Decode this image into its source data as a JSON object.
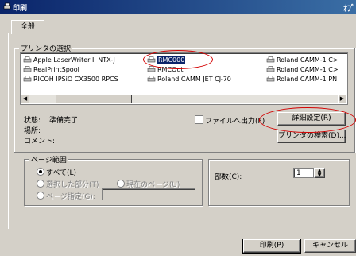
{
  "window": {
    "title": "印刷",
    "corner_mark": "ｵﾌﾟ"
  },
  "tabs": [
    {
      "label": "全般"
    }
  ],
  "printer_group": {
    "title": "プリンタの選択"
  },
  "printers": [
    {
      "name": "Apple LaserWriter II NTX-J",
      "icon": "printer-icon"
    },
    {
      "name": "RMC000",
      "icon": "printer-icon",
      "selected": true
    },
    {
      "name": "Roland CAMM-1 C>",
      "icon": "printer-icon"
    },
    {
      "name": "RealPrintSpool",
      "icon": "printer-icon"
    },
    {
      "name": "RMCOut",
      "icon": "printer-icon"
    },
    {
      "name": "Roland CAMM-1 C>",
      "icon": "printer-icon"
    },
    {
      "name": "RICOH IPSiO CX3500 RPCS",
      "icon": "printer-icon"
    },
    {
      "name": "Roland CAMM JET CJ-70",
      "icon": "printer-icon"
    },
    {
      "name": "Roland CAMM-1 PN",
      "icon": "printer-icon"
    }
  ],
  "status": {
    "state_label": "状態:",
    "state_value": "準備完了",
    "location_label": "場所:",
    "comment_label": "コメント:"
  },
  "file_output": {
    "label": "ファイルへ出力(F)",
    "checked": false
  },
  "buttons": {
    "details": "詳細設定(R)",
    "find_printer": "プリンタの検索(D)...",
    "print": "印刷(P)",
    "cancel": "キャンセル"
  },
  "page_range": {
    "title": "ページ範囲",
    "all": "すべて(L)",
    "selection": "選択した部分(T)",
    "current_page": "現在のページ(U)",
    "pages": "ページ指定(G):",
    "selected": "all"
  },
  "copies": {
    "label": "部数(C):",
    "value": "1"
  },
  "colors": {
    "highlight_ring": "#d40000",
    "selection": "#0a246a",
    "titlebar": "#0a246a"
  }
}
